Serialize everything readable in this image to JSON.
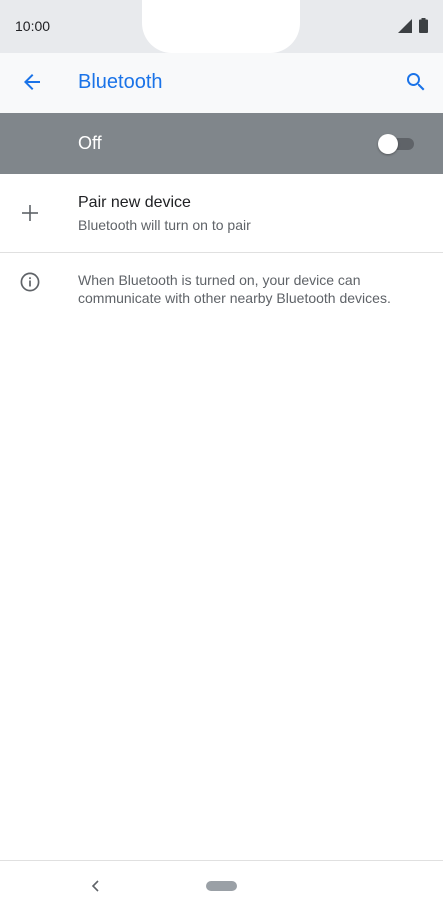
{
  "status_bar": {
    "time": "10:00",
    "icons": [
      "signal-icon",
      "battery-icon"
    ]
  },
  "app_bar": {
    "title": "Bluetooth",
    "back_icon": "arrow-back-icon",
    "search_icon": "search-icon"
  },
  "master_switch": {
    "label": "Off",
    "state": "off"
  },
  "pair_device": {
    "title": "Pair new device",
    "subtitle": "Bluetooth will turn on to pair",
    "icon": "plus-icon"
  },
  "info": {
    "icon": "info-icon",
    "text": "When Bluetooth is turned on, your device can communicate with other nearby Bluetooth devices."
  },
  "nav_bar": {
    "icons": [
      "nav-back-icon",
      "home-pill-icon"
    ]
  },
  "colors": {
    "accent": "#1a73e8",
    "master_bar": "#80868b",
    "status_bar": "#e8eaed",
    "app_bar": "#f8f9fa"
  }
}
